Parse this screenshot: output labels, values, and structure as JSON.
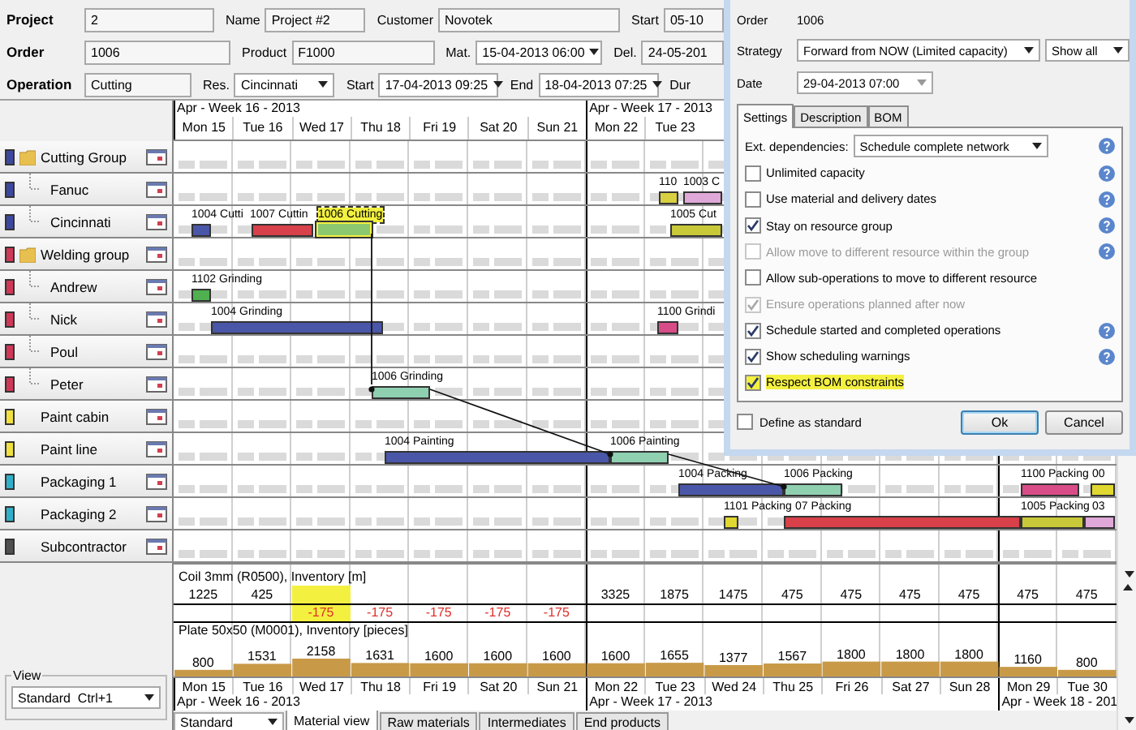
{
  "form": [
    {
      "label": "Project",
      "fields": [
        {
          "kind": "text",
          "value": "2"
        },
        {
          "kind": "text",
          "label": "Name",
          "value": "Project #2"
        },
        {
          "kind": "text",
          "label": "Customer",
          "value": "Novotek"
        },
        {
          "kind": "text",
          "label": "Start",
          "value": "05-10"
        }
      ]
    },
    {
      "label": "Order",
      "fields": [
        {
          "kind": "text",
          "value": "1006"
        },
        {
          "kind": "text",
          "label": "Product",
          "value": "F1000"
        },
        {
          "kind": "dropdown",
          "label": "Mat.",
          "value": "15-04-2013 06:00"
        },
        {
          "kind": "text",
          "label": "Del.",
          "value": "24-05-201"
        }
      ]
    },
    {
      "label": "Operation",
      "fields": [
        {
          "kind": "text",
          "value": "Cutting"
        },
        {
          "kind": "dropdown",
          "label": "Res.",
          "value": "Cincinnati"
        },
        {
          "kind": "dropdown",
          "label": "Start",
          "value": "17-04-2013 09:25"
        },
        {
          "kind": "dropdown",
          "label": "End",
          "value": "18-04-2013 07:25"
        },
        {
          "kind": "label",
          "label": "Dur"
        }
      ]
    }
  ],
  "resources": [
    {
      "name": "Cutting Group",
      "kind": "group",
      "color": "#3c48a0",
      "children": [
        {
          "name": "Fanuc",
          "kind": "member",
          "color": "#3c48a0",
          "bars": [
            {
              "label": "110",
              "color": "#d8d040",
              "selected": false
            },
            {
              "label": "1003 C",
              "color": "#e0a8d8",
              "selected": false
            }
          ]
        },
        {
          "name": "Cincinnati",
          "kind": "member",
          "color": "#3c48a0",
          "bars": [
            {
              "label": "1004 Cutti",
              "color": "#4a56a8",
              "selected": false
            },
            {
              "label": "1007 Cuttin",
              "color": "#d8404a",
              "selected": false
            },
            {
              "label": "1006 Cutting",
              "color": "#8cc870",
              "selected": true
            },
            {
              "label": "1005 Cut",
              "color": "#c8c838",
              "selected": false
            }
          ]
        }
      ]
    },
    {
      "name": "Welding group",
      "kind": "group",
      "color": "#d03858",
      "children": [
        {
          "name": "Andrew",
          "kind": "member",
          "color": "#d03858",
          "bars": [
            {
              "label": "1102 Grinding",
              "color": "#50b050",
              "selected": false
            }
          ]
        },
        {
          "name": "Nick",
          "kind": "member",
          "color": "#d03858",
          "bars": [
            {
              "label": "1004 Grinding",
              "color": "#4a56a8",
              "selected": false
            },
            {
              "label": "1100 Grindi",
              "color": "#d84c88",
              "selected": false
            }
          ]
        },
        {
          "name": "Poul",
          "kind": "member",
          "color": "#d03858"
        },
        {
          "name": "Peter",
          "kind": "member",
          "color": "#d03858",
          "bars": [
            {
              "label": "1006 Grinding",
              "color": "#8fd0b0",
              "selected": false
            }
          ]
        }
      ]
    },
    {
      "name": "Paint cabin",
      "kind": "unit",
      "color": "#f0e040"
    },
    {
      "name": "Paint line",
      "kind": "unit",
      "color": "#f0e040",
      "bars": [
        {
          "label": "1004 Painting",
          "color": "#4a56a8",
          "selected": false
        },
        {
          "label": "1006 Painting",
          "color": "#8fd0b0",
          "selected": false
        }
      ]
    },
    {
      "name": "Packaging 1",
      "kind": "unit",
      "color": "#30b0c8",
      "bars": [
        {
          "label": "1004 Packing",
          "color": "#4a56a8",
          "selected": false
        },
        {
          "label": "1006 Packing",
          "color": "#8fd0b0",
          "selected": false
        },
        {
          "label": "1100 Packing",
          "color": "#d84c88",
          "selected": false
        },
        {
          "label": "00",
          "color": "#e0d830",
          "selected": false
        }
      ]
    },
    {
      "name": "Packaging 2",
      "kind": "unit",
      "color": "#30b0c8",
      "bars": [
        {
          "label": "1101 Packing",
          "color": "#e0d830",
          "selected": false
        },
        {
          "label": "07 Packing",
          "color": "#d8404a",
          "selected": false
        },
        {
          "label": "1005 Packing",
          "color": "#c8c838",
          "selected": false
        },
        {
          "label": "03",
          "color": "#e0a8d8",
          "selected": false
        }
      ]
    },
    {
      "name": "Subcontractor",
      "kind": "unit",
      "color": "#505050"
    }
  ],
  "gantt": {
    "weeks": [
      "Apr - Week 16 - 2013",
      "Apr - Week 17 - 2013"
    ],
    "days": [
      "Mon 15",
      "Tue 16",
      "Wed 17",
      "Thu 18",
      "Fri 19",
      "Sat 20",
      "Sun 21",
      "Mon 22",
      "Tue 23"
    ]
  },
  "materials": [
    {
      "kind": "split",
      "title": "Coil 3mm (R0500), Inventory [m]",
      "cells": [
        {
          "value": "1225",
          "negative": false,
          "highlighted": false
        },
        {
          "value": "425",
          "negative": false,
          "highlighted": false
        },
        {
          "value": "-175",
          "negative": true,
          "highlighted": true
        },
        {
          "value": "-175",
          "negative": true,
          "highlighted": false
        },
        {
          "value": "-175",
          "negative": true,
          "highlighted": false
        },
        {
          "value": "-175",
          "negative": true,
          "highlighted": false
        },
        {
          "value": "-175",
          "negative": true,
          "highlighted": false
        },
        {
          "value": "3325",
          "negative": false,
          "highlighted": false
        },
        {
          "value": "1875",
          "negative": false,
          "highlighted": false
        },
        {
          "value": "1475",
          "negative": false,
          "highlighted": false
        },
        {
          "value": "475",
          "negative": false,
          "highlighted": false
        },
        {
          "value": "475",
          "negative": false,
          "highlighted": false
        },
        {
          "value": "475",
          "negative": false,
          "highlighted": false
        },
        {
          "value": "475",
          "negative": false,
          "highlighted": false
        },
        {
          "value": "475",
          "negative": false,
          "highlighted": false
        },
        {
          "value": "475",
          "negative": false,
          "highlighted": false
        }
      ]
    },
    {
      "kind": "bars",
      "title": "Plate 50x50 (M0001), Inventory [pieces]",
      "chart_data": {
        "type": "bar",
        "categories": [
          "Mon 15",
          "Tue 16",
          "Wed 17",
          "Thu 18",
          "Fri 19",
          "Sat 20",
          "Sun 21",
          "Mon 22",
          "Tue 23",
          "Wed 24",
          "Thu 25",
          "Fri 26",
          "Sat 27",
          "Sun 28",
          "Mon 29",
          "Tue 30"
        ],
        "values": [
          800,
          1531,
          2158,
          1631,
          1600,
          1600,
          1600,
          1600,
          1655,
          1377,
          1567,
          1800,
          1800,
          1800,
          1160,
          800
        ],
        "data_labels": true
      }
    }
  ],
  "bottom_weeks": [
    "Apr - Week 16 - 2013",
    "Apr - Week 17 - 2013",
    "Apr - Week 18 - 201"
  ],
  "view": {
    "label": "View",
    "value": "Standard  Ctrl+1"
  },
  "layout_select": "Standard",
  "tabs": [
    {
      "label": "Material view",
      "selected": true
    },
    {
      "label": "Raw materials",
      "selected": false
    },
    {
      "label": "Intermediates",
      "selected": false
    },
    {
      "label": "End products",
      "selected": false
    }
  ],
  "dialog": {
    "order_label": "Order",
    "order": "1006",
    "strategy_label": "Strategy",
    "strategy": "Forward from NOW (Limited capacity)",
    "filter": "Show all",
    "date_label": "Date",
    "date": "29-04-2013 07:00",
    "tabs": [
      {
        "label": "Settings",
        "selected": true
      },
      {
        "label": "Description",
        "selected": false
      },
      {
        "label": "BOM",
        "selected": false
      }
    ],
    "ext_label": "Ext. dependencies:",
    "ext_value": "Schedule complete network",
    "options": [
      {
        "label": "Unlimited capacity",
        "checked": false,
        "disabled": false,
        "help": true,
        "highlighted": false
      },
      {
        "label": "Use material and delivery dates",
        "checked": false,
        "disabled": false,
        "help": true,
        "highlighted": false
      },
      {
        "label": "Stay on resource group",
        "checked": true,
        "disabled": false,
        "help": true,
        "highlighted": false
      },
      {
        "label": "Allow move to different resource within the group",
        "checked": false,
        "disabled": true,
        "help": true,
        "highlighted": false
      },
      {
        "label": "Allow sub-operations to move to different resource",
        "checked": false,
        "disabled": false,
        "help": false,
        "highlighted": false
      },
      {
        "label": "Ensure operations planned after now",
        "checked": true,
        "disabled": true,
        "help": false,
        "highlighted": false
      },
      {
        "label": "Schedule started and completed operations",
        "checked": true,
        "disabled": false,
        "help": true,
        "highlighted": false
      },
      {
        "label": "Show scheduling warnings",
        "checked": true,
        "disabled": false,
        "help": true,
        "highlighted": false
      },
      {
        "label": "Respect BOM constraints",
        "checked": true,
        "disabled": false,
        "help": false,
        "highlighted": true
      }
    ],
    "define": {
      "label": "Define as standard",
      "checked": false
    },
    "buttons": [
      {
        "label": "Ok",
        "focused": true
      },
      {
        "label": "Cancel",
        "focused": false
      }
    ]
  }
}
